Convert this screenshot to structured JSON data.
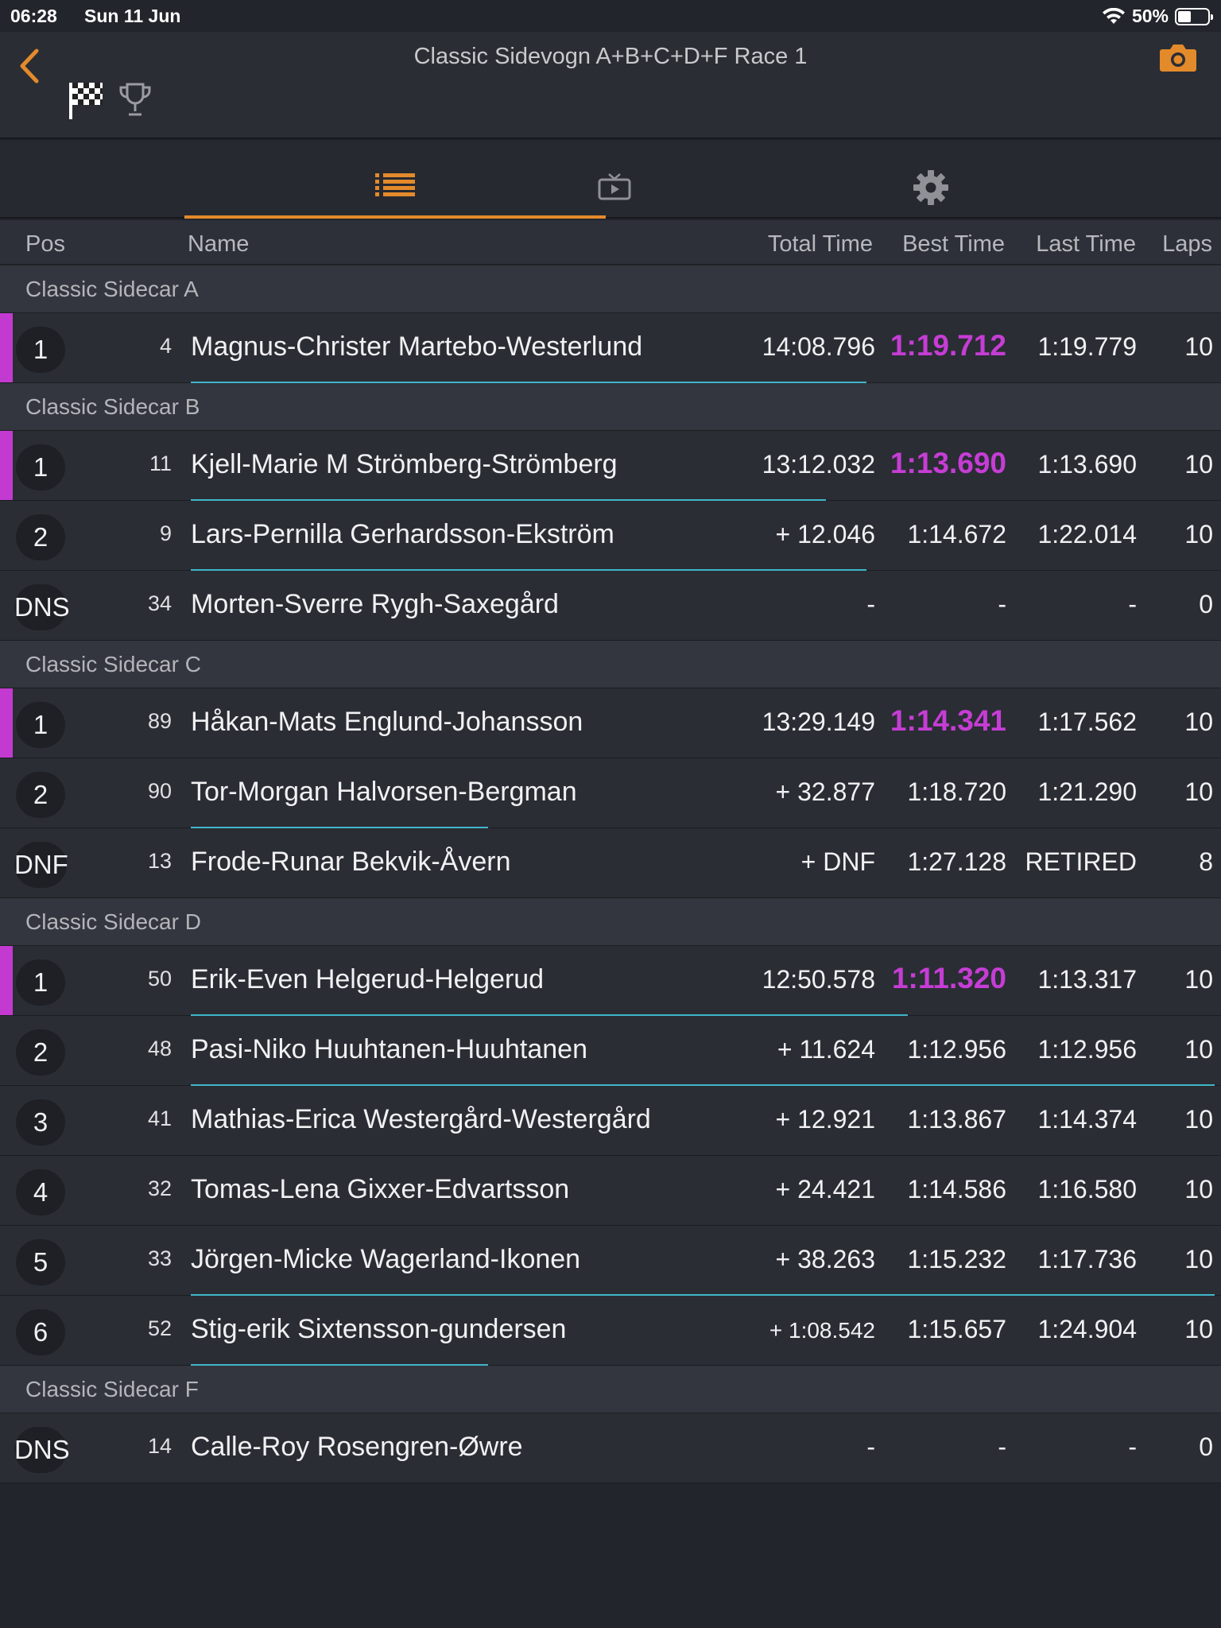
{
  "status": {
    "time": "06:28",
    "date": "Sun 11 Jun",
    "battery": "50%"
  },
  "nav": {
    "title": "Classic Sidevogn A+B+C+D+F Race 1"
  },
  "columns": {
    "pos": "Pos",
    "name": "Name",
    "total": "Total Time",
    "best": "Best Time",
    "last": "Last Time",
    "laps": "Laps"
  },
  "accent_color": "#e38a2b",
  "best_time_color": "#c63dd5",
  "groups": [
    {
      "title": "Classic Sidecar A",
      "rows": [
        {
          "pos": "1",
          "num": "4",
          "name": "Magnus-Christer Martebo-Westerlund",
          "total": "14:08.796",
          "best": "1:19.712",
          "best_highlight": true,
          "last": "1:19.779",
          "laps": "10",
          "leader": true,
          "progress": 0.66
        }
      ]
    },
    {
      "title": "Classic Sidecar B",
      "rows": [
        {
          "pos": "1",
          "num": "11",
          "name": "Kjell-Marie M Strömberg-Strömberg",
          "total": "13:12.032",
          "best": "1:13.690",
          "best_highlight": true,
          "last": "1:13.690",
          "laps": "10",
          "leader": true,
          "progress": 0.62
        },
        {
          "pos": "2",
          "num": "9",
          "name": "Lars-Pernilla Gerhardsson-Ekström",
          "total": "+ 12.046",
          "best": "1:14.672",
          "best_highlight": false,
          "last": "1:22.014",
          "laps": "10",
          "leader": false,
          "progress": 0.66
        },
        {
          "pos": "DNS",
          "num": "34",
          "name": "Morten-Sverre Rygh-Saxegård",
          "total": "-",
          "best": "-",
          "best_highlight": false,
          "last": "-",
          "laps": "0",
          "leader": false,
          "progress": 0
        }
      ]
    },
    {
      "title": "Classic Sidecar C",
      "rows": [
        {
          "pos": "1",
          "num": "89",
          "name": "Håkan-Mats Englund-Johansson",
          "total": "13:29.149",
          "best": "1:14.341",
          "best_highlight": true,
          "last": "1:17.562",
          "laps": "10",
          "leader": true,
          "progress": 0
        },
        {
          "pos": "2",
          "num": "90",
          "name": "Tor-Morgan Halvorsen-Bergman",
          "total": "+ 32.877",
          "best": "1:18.720",
          "best_highlight": false,
          "last": "1:21.290",
          "laps": "10",
          "leader": false,
          "progress": 0.29
        },
        {
          "pos": "DNF",
          "num": "13",
          "name": "Frode-Runar Bekvik-Åvern",
          "total": "+ DNF",
          "best": "1:27.128",
          "best_highlight": false,
          "last": "RETIRED",
          "laps": "8",
          "leader": false,
          "progress": 0
        }
      ]
    },
    {
      "title": "Classic Sidecar D",
      "rows": [
        {
          "pos": "1",
          "num": "50",
          "name": "Erik-Even Helgerud-Helgerud",
          "total": "12:50.578",
          "best": "1:11.320",
          "best_highlight": true,
          "last": "1:13.317",
          "laps": "10",
          "leader": true,
          "progress": 0.7
        },
        {
          "pos": "2",
          "num": "48",
          "name": "Pasi-Niko Huuhtanen-Huuhtanen",
          "total": "+ 11.624",
          "best": "1:12.956",
          "best_highlight": false,
          "last": "1:12.956",
          "laps": "10",
          "leader": false,
          "progress": 1.0
        },
        {
          "pos": "3",
          "num": "41",
          "name": "Mathias-Erica Westergård-Westergård",
          "total": "+ 12.921",
          "best": "1:13.867",
          "best_highlight": false,
          "last": "1:14.374",
          "laps": "10",
          "leader": false,
          "progress": 0
        },
        {
          "pos": "4",
          "num": "32",
          "name": "Tomas-Lena Gixxer-Edvartsson",
          "total": "+ 24.421",
          "best": "1:14.586",
          "best_highlight": false,
          "last": "1:16.580",
          "laps": "10",
          "leader": false,
          "progress": 0
        },
        {
          "pos": "5",
          "num": "33",
          "name": "Jörgen-Micke Wagerland-Ikonen",
          "total": "+ 38.263",
          "best": "1:15.232",
          "best_highlight": false,
          "last": "1:17.736",
          "laps": "10",
          "leader": false,
          "progress": 1.0
        },
        {
          "pos": "6",
          "num": "52",
          "name": "Stig-erik Sixtensson-gundersen",
          "total": "+ 1:08.542",
          "total_small": true,
          "best": "1:15.657",
          "best_highlight": false,
          "last": "1:24.904",
          "laps": "10",
          "leader": false,
          "progress": 0.29
        }
      ]
    },
    {
      "title": "Classic Sidecar F",
      "rows": [
        {
          "pos": "DNS",
          "num": "14",
          "name": "Calle-Roy Rosengren-Øwre",
          "total": "-",
          "best": "-",
          "best_highlight": false,
          "last": "-",
          "laps": "0",
          "leader": false,
          "progress": 0
        }
      ]
    }
  ]
}
